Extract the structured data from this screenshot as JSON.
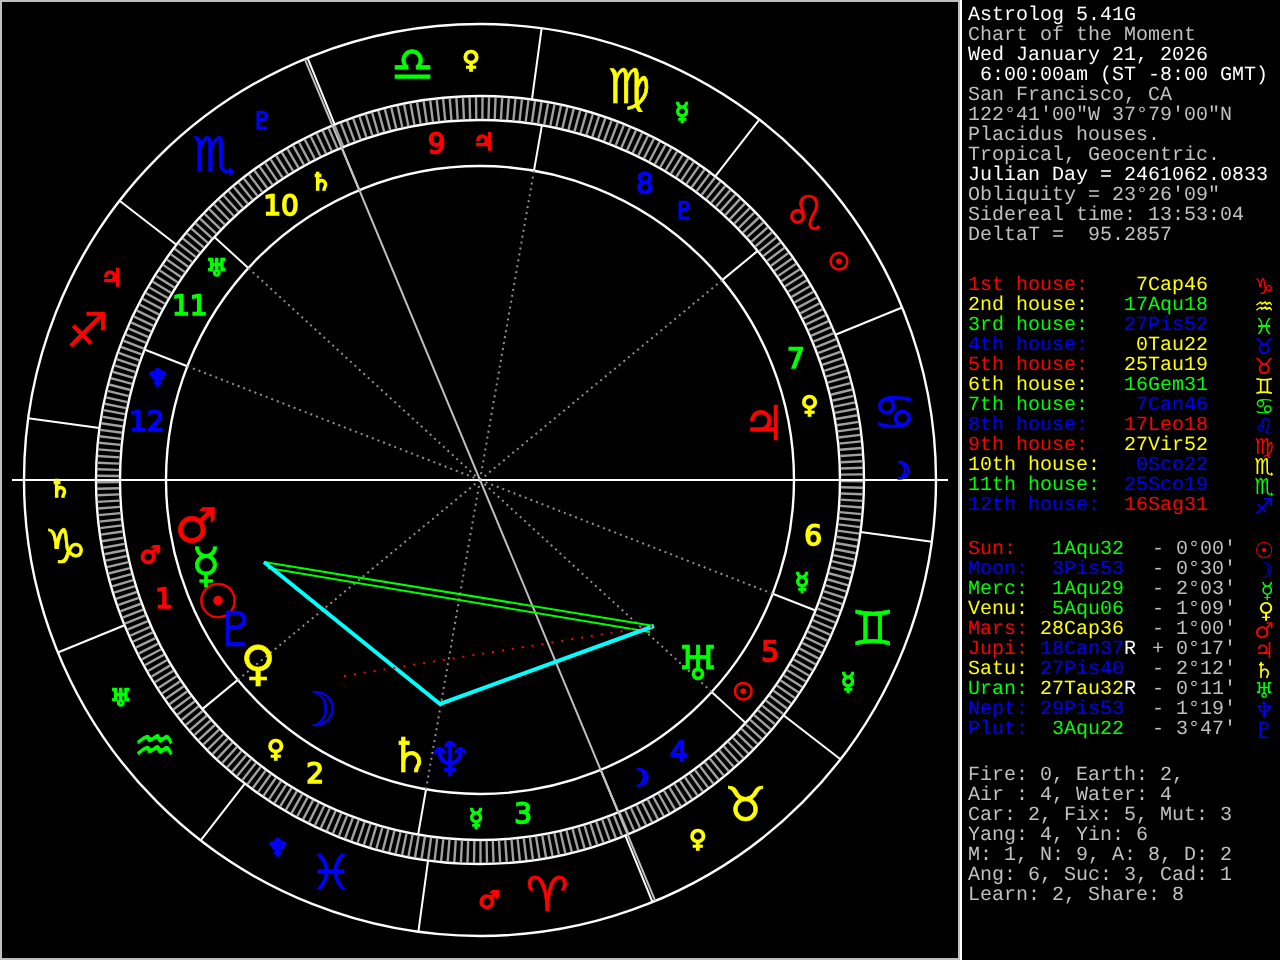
{
  "window": {
    "title": "Astrolog 5.41G"
  },
  "header_lines": [
    {
      "text": "Chart of the Moment",
      "highlighted": false
    },
    {
      "text": "Wed January 21, 2026",
      "highlighted": true
    },
    {
      "text": " 6:00:00am (ST -8:00 GMT)",
      "highlighted": true
    },
    {
      "text": "San Francisco, CA",
      "highlighted": false
    },
    {
      "text": "122°41'00\"W 37°79'00\"N",
      "highlighted": false
    },
    {
      "text": "Placidus houses.",
      "highlighted": false
    },
    {
      "text": "Tropical, Geocentric.",
      "highlighted": false
    },
    {
      "text": "Julian Day = 2461062.0833",
      "highlighted": true
    },
    {
      "text": "Obliquity = 23°26'09\"",
      "highlighted": false
    },
    {
      "text": "Sidereal time: 13:53:04",
      "highlighted": false
    },
    {
      "text": "DeltaT =  95.2857",
      "highlighted": false
    }
  ],
  "houses": [
    {
      "label": "1st house:",
      "color": "#ff0000",
      "cusp": {
        "text": "7Cap46",
        "color": "#ffff00"
      },
      "glyph": "♑"
    },
    {
      "label": "2nd house:",
      "color": "#ffff00",
      "cusp": {
        "text": "17Aqu18",
        "color": "#00ff00"
      },
      "glyph": "♒"
    },
    {
      "label": "3rd house:",
      "color": "#00ff00",
      "cusp": {
        "text": "27Pis52",
        "color": "#0000ff"
      },
      "glyph": "♓"
    },
    {
      "label": "4th house:",
      "color": "#0000ff",
      "cusp": {
        "text": "0Tau22",
        "color": "#ffff00"
      },
      "glyph": "♉"
    },
    {
      "label": "5th house:",
      "color": "#ff0000",
      "cusp": {
        "text": "25Tau19",
        "color": "#ffff00"
      },
      "glyph": "♉"
    },
    {
      "label": "6th house:",
      "color": "#ffff00",
      "cusp": {
        "text": "16Gem31",
        "color": "#00ff00"
      },
      "glyph": "♊"
    },
    {
      "label": "7th house:",
      "color": "#00ff00",
      "cusp": {
        "text": "7Can46",
        "color": "#0000ff"
      },
      "glyph": "♋"
    },
    {
      "label": "8th house:",
      "color": "#0000ff",
      "cusp": {
        "text": "17Leo18",
        "color": "#ff0000"
      },
      "glyph": "♌"
    },
    {
      "label": "9th house:",
      "color": "#ff0000",
      "cusp": {
        "text": "27Vir52",
        "color": "#ffff00"
      },
      "glyph": "♍"
    },
    {
      "label": "10th house:",
      "color": "#ffff00",
      "cusp": {
        "text": "0Sco22",
        "color": "#0000ff"
      },
      "glyph": "♏"
    },
    {
      "label": "11th house:",
      "color": "#00ff00",
      "cusp": {
        "text": "25Sco19",
        "color": "#0000ff"
      },
      "glyph": "♏"
    },
    {
      "label": "12th house:",
      "color": "#0000ff",
      "cusp": {
        "text": "16Sag31",
        "color": "#ff0000"
      },
      "glyph": "♐"
    }
  ],
  "planets": [
    {
      "name": "Sun:",
      "color": "#ff0000",
      "position": {
        "text": "1Aqu32",
        "color": "#00ff00"
      },
      "latitude": "- 0°00'",
      "glyph": "☉"
    },
    {
      "name": "Moon:",
      "color": "#0000ff",
      "position": {
        "text": "3Pis53",
        "color": "#0000ff"
      },
      "latitude": "- 0°30'",
      "glyph": "☽"
    },
    {
      "name": "Merc:",
      "color": "#00ff00",
      "position": {
        "text": "1Aqu29",
        "color": "#00ff00"
      },
      "latitude": "- 2°03'",
      "glyph": "☿"
    },
    {
      "name": "Venu:",
      "color": "#ffff00",
      "position": {
        "text": "5Aqu06",
        "color": "#00ff00"
      },
      "latitude": "- 1°09'",
      "glyph": "♀"
    },
    {
      "name": "Mars:",
      "color": "#ff0000",
      "position": {
        "text": "28Cap36",
        "color": "#ffff00"
      },
      "latitude": "- 1°00'",
      "glyph": "♂"
    },
    {
      "name": "Jupi:",
      "color": "#ff0000",
      "position": {
        "text": "18Can37",
        "color": "#0000ff"
      },
      "retro": "R",
      "latitude": "+ 0°17'",
      "glyph": "♃"
    },
    {
      "name": "Satu:",
      "color": "#ffff00",
      "position": {
        "text": "27Pis40",
        "color": "#0000ff"
      },
      "latitude": "- 2°12'",
      "glyph": "♄"
    },
    {
      "name": "Uran:",
      "color": "#00ff00",
      "position": {
        "text": "27Tau32",
        "color": "#ffff00"
      },
      "retro": "R",
      "latitude": "- 0°11'",
      "glyph": "♅"
    },
    {
      "name": "Nept:",
      "color": "#0000ff",
      "position": {
        "text": "29Pis53",
        "color": "#0000ff"
      },
      "latitude": "- 1°19'",
      "glyph": "♆"
    },
    {
      "name": "Plut:",
      "color": "#0000ff",
      "position": {
        "text": "3Aqu22",
        "color": "#00ff00"
      },
      "latitude": "- 3°47'",
      "glyph": "♇"
    }
  ],
  "summary": [
    "Fire: 0, Earth: 2,",
    "Air : 4, Water: 4",
    "Car: 2, Fix: 5, Mut: 3",
    "Yang: 4, Yin: 6",
    "M: 1, N: 9, A: 8, D: 2",
    "Ang: 6, Suc: 3, Cad: 1",
    "Learn: 2, Share: 8"
  ],
  "wheel": {
    "signs": [
      {
        "glyph": "♈",
        "color": "#ff0000",
        "ruler": {
          "glyph": "♂",
          "color": "#ff0000"
        }
      },
      {
        "glyph": "♉",
        "color": "#ffff00",
        "ruler": {
          "glyph": "♀",
          "color": "#ffff00"
        }
      },
      {
        "glyph": "♊",
        "color": "#00ff00",
        "ruler": {
          "glyph": "☿",
          "color": "#00ff00"
        }
      },
      {
        "glyph": "♋",
        "color": "#0000ff",
        "ruler": {
          "glyph": "☽",
          "color": "#0000ff"
        }
      },
      {
        "glyph": "♌",
        "color": "#ff0000",
        "ruler": {
          "glyph": "☉",
          "color": "#ff0000"
        }
      },
      {
        "glyph": "♍",
        "color": "#ffff00",
        "ruler": {
          "glyph": "☿",
          "color": "#00ff00"
        }
      },
      {
        "glyph": "♎",
        "color": "#00ff00",
        "ruler": {
          "glyph": "♀",
          "color": "#ffff00"
        }
      },
      {
        "glyph": "♏",
        "color": "#0000ff",
        "ruler": {
          "glyph": "♇",
          "color": "#0000ff"
        }
      },
      {
        "glyph": "♐",
        "color": "#ff0000",
        "ruler": {
          "glyph": "♃",
          "color": "#ff0000"
        }
      },
      {
        "glyph": "♑",
        "color": "#ffff00",
        "ruler": {
          "glyph": "♄",
          "color": "#ffff00"
        }
      },
      {
        "glyph": "♒",
        "color": "#00ff00",
        "ruler": {
          "glyph": "♅",
          "color": "#00ff00"
        }
      },
      {
        "glyph": "♓",
        "color": "#0000ff",
        "ruler": {
          "glyph": "♆",
          "color": "#0000ff"
        }
      }
    ],
    "houses": [
      {
        "number": "1",
        "color": "#ff0000",
        "ruler": {
          "glyph": "♂",
          "color": "#ff0000"
        }
      },
      {
        "number": "2",
        "color": "#ffff00",
        "ruler": {
          "glyph": "♀",
          "color": "#ffff00"
        }
      },
      {
        "number": "3",
        "color": "#00ff00",
        "ruler": {
          "glyph": "☿",
          "color": "#00ff00"
        }
      },
      {
        "number": "4",
        "color": "#0000ff",
        "ruler": {
          "glyph": "☽",
          "color": "#0000ff"
        }
      },
      {
        "number": "5",
        "color": "#ff0000",
        "ruler": {
          "glyph": "☉",
          "color": "#ff0000"
        }
      },
      {
        "number": "6",
        "color": "#ffff00",
        "ruler": {
          "glyph": "☿",
          "color": "#00ff00"
        }
      },
      {
        "number": "7",
        "color": "#00ff00",
        "ruler": {
          "glyph": "♀",
          "color": "#ffff00"
        }
      },
      {
        "number": "8",
        "color": "#0000ff",
        "ruler": {
          "glyph": "♇",
          "color": "#0000ff"
        }
      },
      {
        "number": "9",
        "color": "#ff0000",
        "ruler": {
          "glyph": "♃",
          "color": "#ff0000"
        }
      },
      {
        "number": "10",
        "color": "#ffff00",
        "ruler": {
          "glyph": "♄",
          "color": "#ffff00"
        }
      },
      {
        "number": "11",
        "color": "#00ff00",
        "ruler": {
          "glyph": "♅",
          "color": "#00ff00"
        }
      },
      {
        "number": "12",
        "color": "#0000ff",
        "ruler": {
          "glyph": "♆",
          "color": "#0000ff"
        }
      }
    ]
  }
}
